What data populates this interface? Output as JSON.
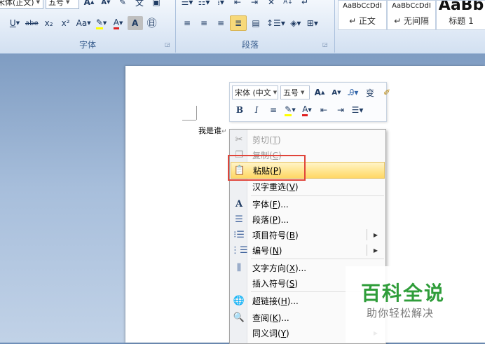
{
  "ribbon": {
    "font_name": "宋体(正文)",
    "font_size": "五号",
    "font_group_label": "字体",
    "paragraph_group_label": "段落",
    "styles": [
      {
        "preview": "AaBbCcDdI",
        "name": "↵ 正文"
      },
      {
        "preview": "AaBbCcDdI",
        "name": "↵ 无间隔"
      },
      {
        "preview": "AaBb",
        "name": "标题 1"
      }
    ],
    "font_tools": [
      "U",
      "abe",
      "x₂",
      "x²",
      "Aa"
    ],
    "text_highlight_letter": "A",
    "font_grow": "A",
    "font_shrink": "A",
    "char_shading": "A",
    "enclose_char": "㊐",
    "sort_icon_label": "A↓"
  },
  "document": {
    "text": "我是谁"
  },
  "mini_toolbar": {
    "font": "宋体 (中文",
    "size": "五号",
    "grow": "A",
    "shrink": "A",
    "bold": "B",
    "italic": "I",
    "font_color": "A"
  },
  "context_menu": {
    "items": [
      {
        "label": "剪切",
        "key": "T",
        "enabled": false,
        "icon": "scissors-icon"
      },
      {
        "label": "复制",
        "key": "C",
        "enabled": false,
        "icon": "copy-icon"
      },
      {
        "label": "粘贴",
        "key": "P",
        "enabled": true,
        "icon": "paste-icon",
        "highlighted": true
      },
      {
        "label": "汉字重选",
        "key": "V",
        "enabled": true,
        "icon": ""
      },
      {
        "label": "字体",
        "key": "F",
        "enabled": true,
        "icon": "font-icon",
        "suffix": "..."
      },
      {
        "label": "段落",
        "key": "P",
        "enabled": true,
        "icon": "paragraph-icon",
        "suffix": "..."
      },
      {
        "label": "项目符号",
        "key": "B",
        "enabled": true,
        "icon": "bullets-icon",
        "submenu": true
      },
      {
        "label": "编号",
        "key": "N",
        "enabled": true,
        "icon": "numbering-icon",
        "submenu": true
      },
      {
        "label": "文字方向",
        "key": "X",
        "enabled": true,
        "icon": "text-direction-icon",
        "suffix": "..."
      },
      {
        "label": "插入符号",
        "key": "S",
        "enabled": true,
        "icon": ""
      },
      {
        "label": "超链接",
        "key": "H",
        "enabled": true,
        "icon": "hyperlink-icon",
        "suffix": "..."
      },
      {
        "label": "查阅",
        "key": "K",
        "enabled": true,
        "icon": "lookup-icon",
        "suffix": "..."
      },
      {
        "label": "同义词",
        "key": "Y",
        "enabled": true,
        "icon": "",
        "submenu": true
      }
    ]
  },
  "watermark": {
    "title": "百科全说",
    "subtitle": "助你轻松解决"
  },
  "colors": {
    "highlight": "#ffe58f",
    "callout_red": "#e0443a",
    "watermark_green": "#2f9d3a"
  }
}
